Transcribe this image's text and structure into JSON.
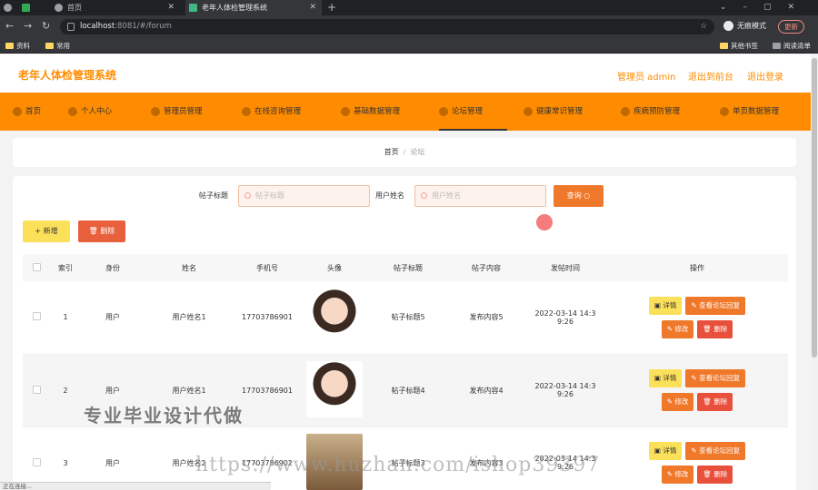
{
  "browser": {
    "tabs": [
      {
        "label": ""
      },
      {
        "label": "首页"
      },
      {
        "label": "老年人体检管理系统"
      }
    ],
    "url": "localhost:8081/#/forum",
    "url_host": "localhost",
    "url_path": ":8081/#/forum",
    "incognito_label": "无痕模式",
    "update_label": "更新",
    "bookmarks": [
      "资料",
      "常用"
    ],
    "bookmarks_right": [
      "其他书签",
      "阅读清单"
    ]
  },
  "header": {
    "title": "老年人体检管理系统",
    "user": "管理员 admin",
    "back_front": "退出到前台",
    "logout": "退出登录"
  },
  "menu": [
    {
      "label": "首页",
      "icon": "home-icon"
    },
    {
      "label": "个人中心",
      "icon": "user-icon"
    },
    {
      "label": "管理员管理",
      "icon": "admin-icon"
    },
    {
      "label": "在线咨询管理",
      "icon": "chat-icon"
    },
    {
      "label": "基础数据管理",
      "icon": "data-icon"
    },
    {
      "label": "论坛管理",
      "icon": "forum-icon"
    },
    {
      "label": "健康常识管理",
      "icon": "health-icon"
    },
    {
      "label": "疾病预防管理",
      "icon": "prevention-icon"
    },
    {
      "label": "单页数据管理",
      "icon": "page-icon"
    }
  ],
  "breadcrumb": {
    "home": "首页",
    "sep": "/",
    "current": "论坛"
  },
  "search": {
    "title_label": "帖子标题",
    "title_placeholder": "帖子标题",
    "user_label": "用户姓名",
    "user_placeholder": "用户姓名",
    "button": "查询"
  },
  "actions": {
    "add": "+ 新增",
    "delete": "删除"
  },
  "table": {
    "headers": [
      "",
      "索引",
      "身份",
      "姓名",
      "手机号",
      "头像",
      "帖子标题",
      "帖子内容",
      "发帖时间",
      "操作"
    ],
    "rows": [
      {
        "index": "1",
        "role": "用户",
        "name": "用户姓名1",
        "phone": "17703786901",
        "title": "帖子标题5",
        "content": "发布内容5",
        "time_a": "2022-03-14 14:3",
        "time_b": "9:26"
      },
      {
        "index": "2",
        "role": "用户",
        "name": "用户姓名1",
        "phone": "17703786901",
        "title": "帖子标题4",
        "content": "发布内容4",
        "time_a": "2022-03-14 14:3",
        "time_b": "9:26"
      },
      {
        "index": "3",
        "role": "用户",
        "name": "用户姓名2",
        "phone": "17703786902",
        "title": "帖子标题3",
        "content": "发布内容3",
        "time_a": "2022-03-14 14:3",
        "time_b": "9:26"
      }
    ],
    "ops": {
      "detail": "详情",
      "reply": "查看论坛回复",
      "edit": "修改",
      "del": "删除"
    }
  },
  "overlay": {
    "watermark_cn": "专业毕业设计代做",
    "watermark_url": "https://www.huzhan.com/ishop39397",
    "status": "正在连接..."
  }
}
